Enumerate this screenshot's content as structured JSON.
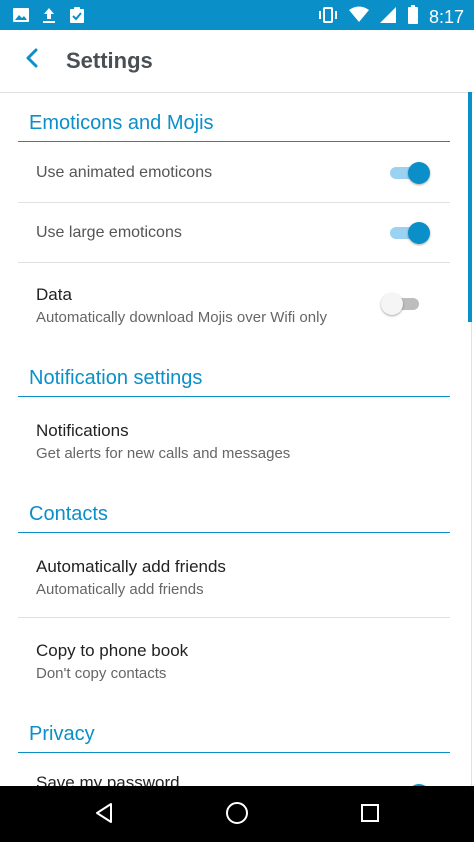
{
  "status_bar": {
    "time": "8:17",
    "left_icons": [
      "image-icon",
      "upload-icon",
      "clipboard-check-icon"
    ],
    "right_icons": [
      "vibrate-icon",
      "wifi-icon",
      "signal-icon",
      "battery-icon"
    ]
  },
  "app_bar": {
    "title": "Settings",
    "back_icon": "chevron-left-icon"
  },
  "colors": {
    "accent": "#0a8fc9",
    "status_bar": "#0a8fc9",
    "toggle_on_track": "#9cd2f1"
  },
  "sections": {
    "emoticons": {
      "header": "Emoticons and Mojis",
      "animated": {
        "label": "Use animated emoticons",
        "on": true
      },
      "large": {
        "label": "Use large emoticons",
        "on": true
      },
      "data": {
        "title": "Data",
        "subtitle": "Automatically download Mojis over Wifi only",
        "on": false
      }
    },
    "notifications": {
      "header": "Notification settings",
      "item": {
        "title": "Notifications",
        "subtitle": "Get alerts for new calls and messages"
      }
    },
    "contacts": {
      "header": "Contacts",
      "add_friends": {
        "title": "Automatically add friends",
        "subtitle": "Automatically add friends"
      },
      "phone_book": {
        "title": "Copy to phone book",
        "subtitle": "Don't copy contacts"
      }
    },
    "privacy": {
      "header": "Privacy",
      "save_password": {
        "title": "Save my password",
        "on": true
      }
    }
  },
  "nav_bar": {
    "buttons": [
      "back-triangle-icon",
      "home-circle-icon",
      "recents-square-icon"
    ]
  }
}
